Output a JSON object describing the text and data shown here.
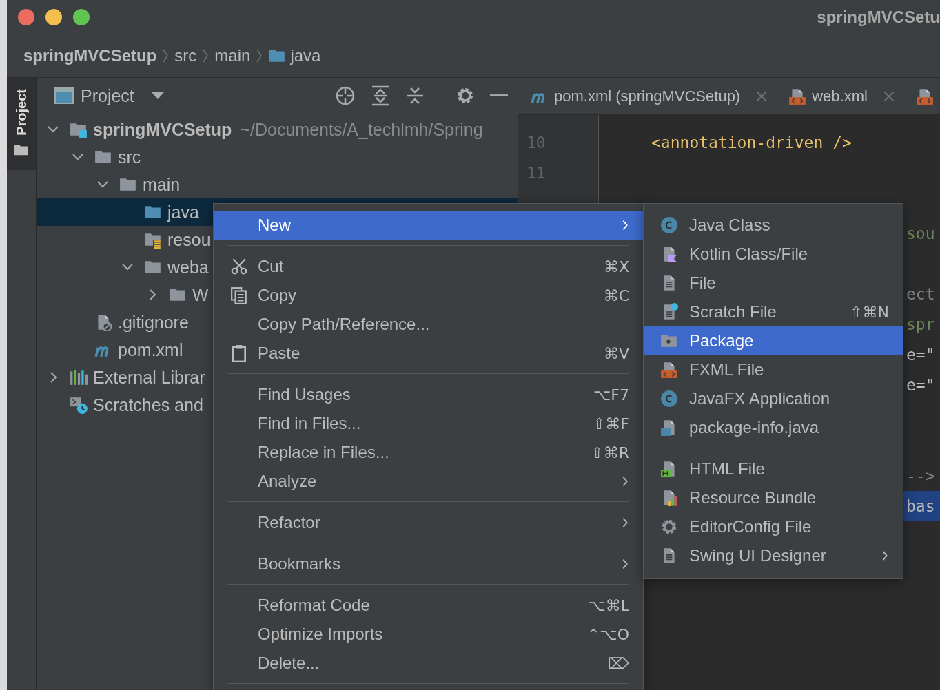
{
  "window": {
    "title": "springMVCSetu"
  },
  "breadcrumbs": [
    {
      "label": "springMVCSetup",
      "kind": "module"
    },
    {
      "label": "src",
      "kind": "plain"
    },
    {
      "label": "main",
      "kind": "plain"
    },
    {
      "label": "java",
      "kind": "folder"
    }
  ],
  "side_tab": {
    "label": "Project",
    "selected": true
  },
  "project_panel": {
    "title": "Project",
    "tree": [
      {
        "label": "springMVCSetup",
        "path": "~/Documents/A_techlmh/Spring",
        "kind": "module",
        "expanded": true,
        "selected": false,
        "children": [
          {
            "label": "src",
            "kind": "folder",
            "expanded": true,
            "selected": false,
            "children": [
              {
                "label": "main",
                "kind": "folder",
                "expanded": true,
                "selected": false,
                "children": [
                  {
                    "label": "java",
                    "kind": "source-folder",
                    "selected": true
                  },
                  {
                    "label": "resou",
                    "kind": "resource-folder",
                    "selected": false
                  },
                  {
                    "label": "weba",
                    "kind": "folder",
                    "expanded": true,
                    "selected": false,
                    "children": [
                      {
                        "label": "W",
                        "kind": "folder",
                        "expanded": false,
                        "selected": false
                      }
                    ]
                  }
                ]
              }
            ]
          },
          {
            "label": ".gitignore",
            "kind": "ignored-file",
            "selected": false
          },
          {
            "label": "pom.xml",
            "kind": "maven",
            "selected": false
          }
        ]
      },
      {
        "label": "External Librar",
        "kind": "libraries",
        "expanded": false,
        "selected": false
      },
      {
        "label": "Scratches and",
        "kind": "scratches",
        "selected": false
      }
    ]
  },
  "editor": {
    "tabs": [
      {
        "label": "pom.xml (springMVCSetup)",
        "kind": "maven",
        "closable": true
      },
      {
        "label": "web.xml",
        "kind": "xml",
        "closable": true
      },
      {
        "kind": "xml",
        "closable": false
      }
    ],
    "lines": [
      {
        "number": "10",
        "text": "<annotation-driven />",
        "kind": "tag",
        "clipped": false,
        "selected": false
      },
      {
        "number": "11",
        "kind": "blank"
      },
      {
        "kind": "blank"
      },
      {
        "text": "sou",
        "kind": "string",
        "clipped": true,
        "selected": false
      },
      {
        "kind": "blank"
      },
      {
        "text": "ect",
        "kind": "comment",
        "clipped": true,
        "selected": false
      },
      {
        "text": "spr",
        "kind": "string",
        "clipped": true,
        "selected": false
      },
      {
        "text": "e=\"",
        "kind": "plain",
        "clipped": true,
        "selected": false
      },
      {
        "text": "e=\"",
        "kind": "plain",
        "clipped": true,
        "selected": false
      },
      {
        "kind": "blank"
      },
      {
        "kind": "blank"
      },
      {
        "text": "-->",
        "kind": "comment",
        "clipped": true,
        "selected": false
      },
      {
        "text": "bas",
        "kind": "plain",
        "clipped": true,
        "selected": true
      }
    ]
  },
  "context_menu": {
    "groups": [
      [
        {
          "label": "New",
          "kind": "plain",
          "arrow": true,
          "selected": true
        }
      ],
      [
        {
          "label": "Cut",
          "kind": "cut",
          "shortcut": "⌘X",
          "arrow": false,
          "selected": false
        },
        {
          "label": "Copy",
          "kind": "copy",
          "shortcut": "⌘C",
          "arrow": false,
          "selected": false
        },
        {
          "label": "Copy Path/Reference...",
          "kind": "plain",
          "arrow": false,
          "selected": false
        },
        {
          "label": "Paste",
          "kind": "paste",
          "shortcut": "⌘V",
          "arrow": false,
          "selected": false
        }
      ],
      [
        {
          "label": "Find Usages",
          "kind": "plain",
          "shortcut": "⌥F7",
          "arrow": false,
          "selected": false
        },
        {
          "label": "Find in Files...",
          "kind": "plain",
          "shortcut": "⇧⌘F",
          "arrow": false,
          "selected": false
        },
        {
          "label": "Replace in Files...",
          "kind": "plain",
          "shortcut": "⇧⌘R",
          "arrow": false,
          "selected": false
        },
        {
          "label": "Analyze",
          "kind": "plain",
          "arrow": true,
          "selected": false
        }
      ],
      [
        {
          "label": "Refactor",
          "kind": "plain",
          "arrow": true,
          "selected": false
        }
      ],
      [
        {
          "label": "Bookmarks",
          "kind": "plain",
          "arrow": true,
          "selected": false
        }
      ],
      [
        {
          "label": "Reformat Code",
          "kind": "plain",
          "shortcut": "⌥⌘L",
          "arrow": false,
          "selected": false
        },
        {
          "label": "Optimize Imports",
          "kind": "plain",
          "shortcut": "⌃⌥O",
          "arrow": false,
          "selected": false
        },
        {
          "label": "Delete...",
          "kind": "plain",
          "shortcut": "⌦",
          "arrow": false,
          "selected": false
        }
      ]
    ]
  },
  "new_submenu": {
    "groups": [
      [
        {
          "label": "Java Class",
          "kind": "java-class",
          "arrow": false,
          "selected": false
        },
        {
          "label": "Kotlin Class/File",
          "kind": "kotlin",
          "arrow": false,
          "selected": false
        },
        {
          "label": "File",
          "kind": "file",
          "arrow": false,
          "selected": false
        },
        {
          "label": "Scratch File",
          "kind": "scratch",
          "shortcut": "⇧⌘N",
          "arrow": false,
          "selected": false
        },
        {
          "label": "Package",
          "kind": "package",
          "arrow": false,
          "selected": true
        },
        {
          "label": "FXML File",
          "kind": "xml",
          "arrow": false,
          "selected": false
        },
        {
          "label": "JavaFX Application",
          "kind": "java-class",
          "arrow": false,
          "selected": false
        },
        {
          "label": "package-info.java",
          "kind": "package-info",
          "arrow": false,
          "selected": false
        }
      ],
      [
        {
          "label": "HTML File",
          "kind": "html",
          "arrow": false,
          "selected": false
        },
        {
          "label": "Resource Bundle",
          "kind": "bundle",
          "arrow": false,
          "selected": false
        },
        {
          "label": "EditorConfig File",
          "kind": "gear",
          "arrow": false,
          "selected": false
        },
        {
          "label": "Swing UI Designer",
          "kind": "file",
          "arrow": true,
          "selected": false
        }
      ]
    ]
  }
}
